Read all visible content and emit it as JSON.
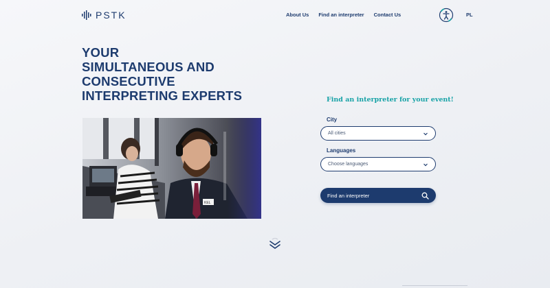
{
  "header": {
    "logo_text": "PSTK",
    "nav": [
      "About Us",
      "Find an interpreter",
      "Contact Us"
    ],
    "language": "PL",
    "accessibility_icon": "accessibility-icon"
  },
  "hero": {
    "title_lines": [
      "YOUR",
      "SIMULTANEOUS AND",
      "CONSECUTIVE",
      "INTERPRETING EXPERTS"
    ],
    "badge_text": "KEL"
  },
  "search_form": {
    "title": "Find an interpreter for your event!",
    "city_label": "City",
    "city_value": "All cities",
    "languages_label": "Languages",
    "languages_placeholder": "Choose languages",
    "submit_label": "Find an interpreter",
    "submit_icon": "search-icon"
  },
  "scroll_icon": "double-chevron-down-icon",
  "colors": {
    "primary": "#1d3b6e",
    "accent": "#17a2a6",
    "background": "#f2f4f7"
  }
}
